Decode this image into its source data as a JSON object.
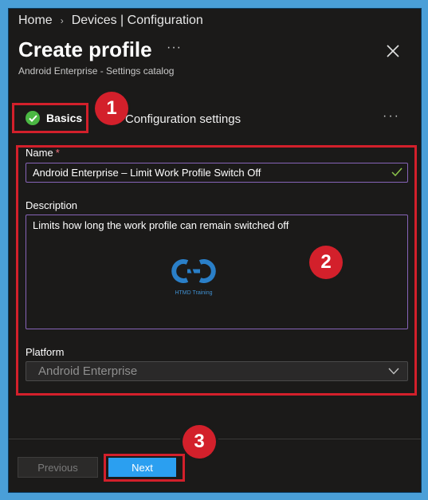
{
  "breadcrumb": {
    "home": "Home",
    "current": "Devices | Configuration"
  },
  "header": {
    "title": "Create profile",
    "more": "···",
    "subtitle": "Android Enterprise - Settings catalog"
  },
  "tabs": {
    "basics": "Basics",
    "configuration": "Configuration settings",
    "more": "···"
  },
  "badges": {
    "one": "1",
    "two": "2",
    "three": "3"
  },
  "form": {
    "name_label": "Name",
    "required_mark": "*",
    "name_value": "Android Enterprise – Limit Work Profile Switch Off",
    "description_label": "Description",
    "description_value": "Limits how long the work profile can remain switched off",
    "platform_label": "Platform",
    "platform_value": "Android Enterprise"
  },
  "watermark": {
    "text": "HTMD Training"
  },
  "footer": {
    "previous": "Previous",
    "next": "Next"
  },
  "colors": {
    "panel_bg": "#1b1a19",
    "highlight_red": "#d3202b",
    "accent_blue": "#2b9ff0",
    "success_green": "#4bb843",
    "input_border": "#8764b8"
  }
}
